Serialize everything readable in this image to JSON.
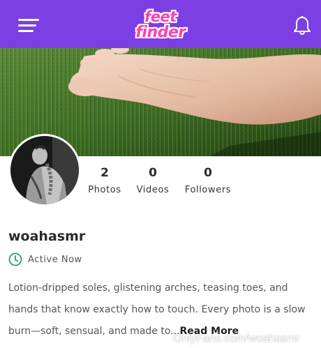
{
  "header": {
    "logo_line1": "feet",
    "logo_line2": "finder",
    "bg_color": "#7b3fe4",
    "logo_color": "#ff3fb4"
  },
  "icons": {
    "menu": "hamburger-menu-icon",
    "notifications": "bell-icon",
    "status": "clock-icon"
  },
  "profile": {
    "username": "woahasmr",
    "status_text": "Active Now",
    "status_color": "#2e9b6a"
  },
  "stats": [
    {
      "value": "2",
      "label": "Photos"
    },
    {
      "value": "0",
      "label": "Videos"
    },
    {
      "value": "0",
      "label": "Followers"
    }
  ],
  "bio": {
    "text": "Lotion-dripped soles, glistening arches, teasing toes, and hands that know exactly how to touch. Every photo is a slow burn—soft, sensual, and made to...",
    "read_more": "Read More"
  },
  "watermark": "OnlyFans.com/woahasmr"
}
